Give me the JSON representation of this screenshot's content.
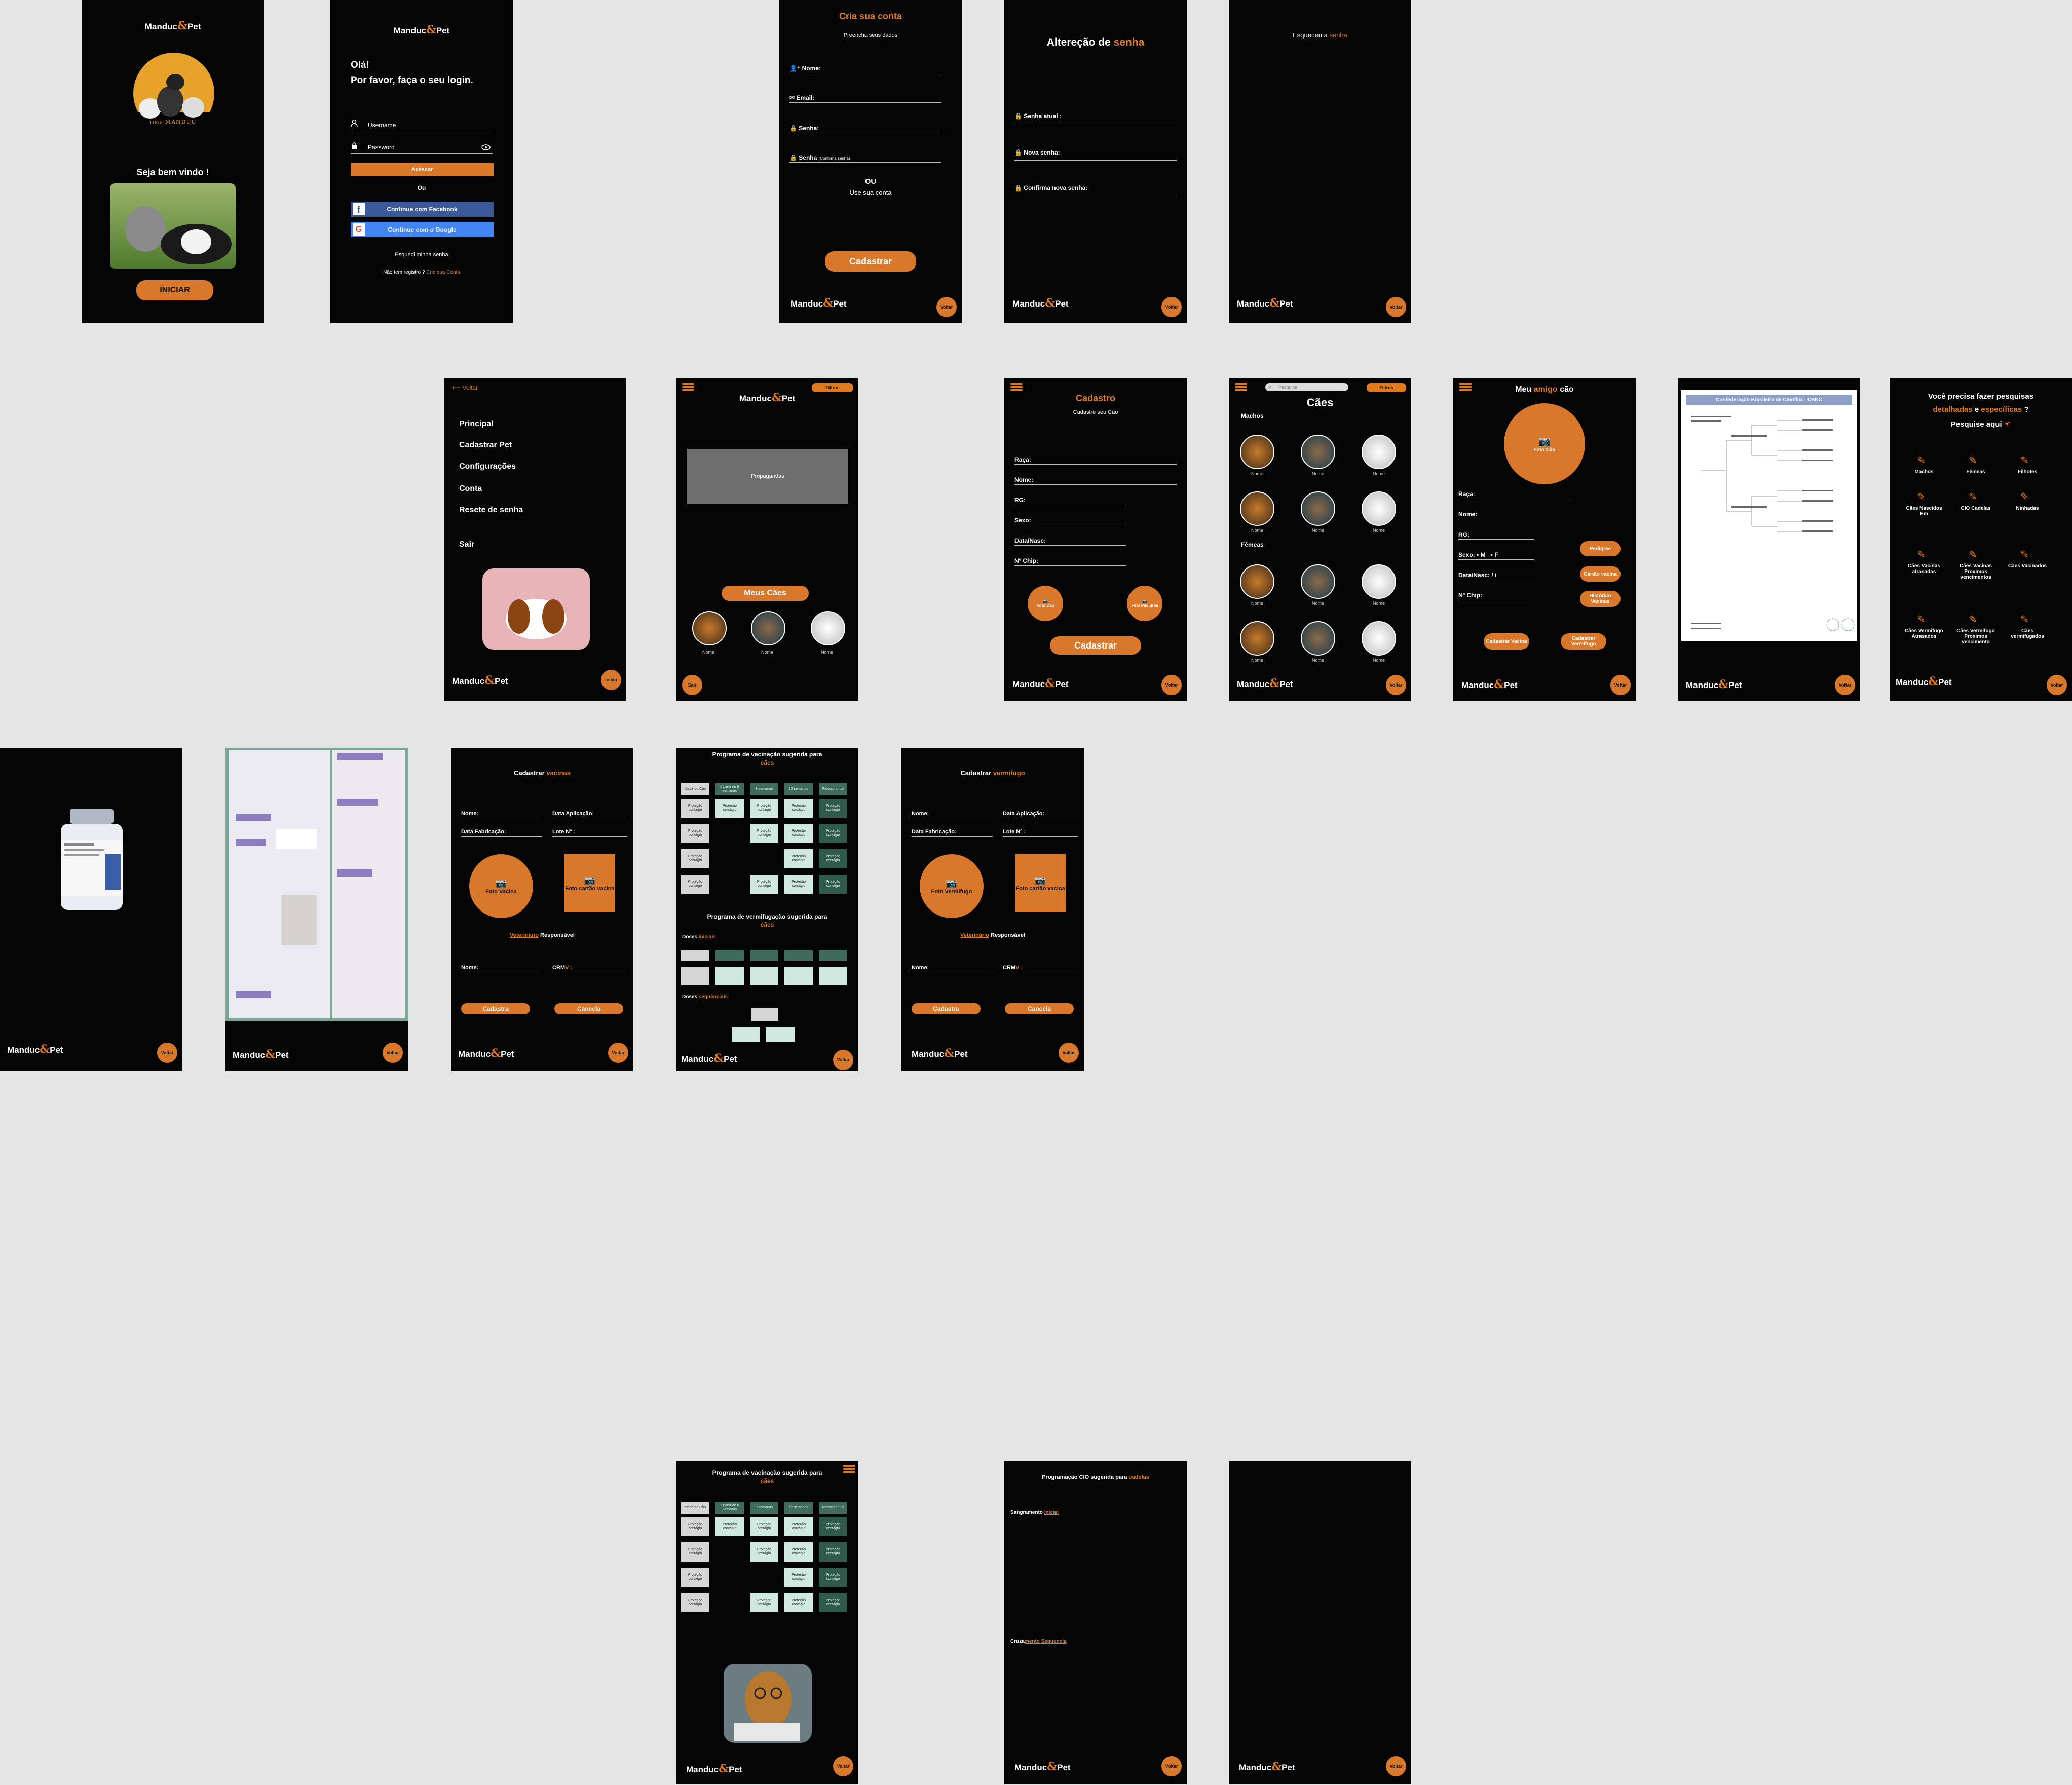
{
  "brand": {
    "manduc": "Manduc",
    "amp": "&",
    "pet": "Pet"
  },
  "common": {
    "voltar": "Voltar",
    "inicio": "Início"
  },
  "welcome": {
    "badge_sub": "TIME",
    "badge_name": "MANDUC",
    "greeting": "Seja bem vindo !",
    "start": "INICIAR"
  },
  "login": {
    "hello": "Olá!",
    "prompt": "Por favor, faça o seu login.",
    "username": "Username",
    "password": "Password",
    "access": "Acessar",
    "or": "Ou",
    "facebook": "Continue com Facebook",
    "google": "Continue com o Google",
    "forgot": "Esqueci minha senha",
    "no_account": "Não tem registro ?",
    "create": "Crie sua Conta"
  },
  "signup": {
    "title": "Cria sua conta",
    "subtitle": "Preencha seus dados",
    "name": "Nome:",
    "email": "Email:",
    "password": "Senha:",
    "confirm": "Senha",
    "confirm_small": "(Confirma senha)",
    "or": "OU",
    "use_account": "Use sua conta",
    "submit": "Cadastrar"
  },
  "pwchange": {
    "title_a": "Altereção de",
    "title_b": "senha",
    "current": "Senha atual :",
    "new": "Nova senha:",
    "confirm": "Confirma nova senha:"
  },
  "forgot": {
    "title_a": "Esqueceu a",
    "title_b": "senha"
  },
  "menu": {
    "back": "Voltar",
    "items": [
      "Principal",
      "Cadastrar Pet",
      "Configurações",
      "Conta",
      "Resete de senha"
    ],
    "exit": "Sair",
    "start": "Início"
  },
  "home": {
    "filters": "Filtros",
    "ads": "Propagandas",
    "my_dogs": "Meus Cães",
    "dog_name": "Nome",
    "exit": "Sair"
  },
  "register": {
    "title": "Cadastro",
    "subtitle": "Cadastre seu Cão",
    "fields": [
      "Raça:",
      "Nome:",
      "RG:",
      "Sexo:",
      "Data/Nasc:",
      "Nº Chip:"
    ],
    "photo_dog": "Foto Cão",
    "photo_ped": "Foto Pedigree",
    "submit": "Cadastrar"
  },
  "list": {
    "search": "Pesquisa",
    "filters": "Filtros",
    "title": "Cães",
    "males": "Machos",
    "females": "Fêmeas",
    "dog_name": "Nome"
  },
  "friend": {
    "title_a": "Meu",
    "title_b": "amigo",
    "title_c": "cão",
    "photo": "Foto Cão",
    "fields": [
      "Raça:",
      "Nome:",
      "RG:",
      "Sexo:",
      "Data/Nasc:",
      "Nº Chip:"
    ],
    "sex_m": "M",
    "sex_f": "F",
    "date_sep": "/   /",
    "btn_ped": "Pedigree",
    "btn_card": "Cartão vacina",
    "btn_hist": "Histórico Vacinas",
    "btn_vac": "Cadastrar Vacina",
    "btn_verm": "Cadastrar Vermifugo"
  },
  "pedigree": {
    "header": "Confederação Brasileira de Cinofilia - CBKC"
  },
  "search": {
    "title_a": "Você precisa fazer pesquisas",
    "title_b": "detalhadas",
    "title_c": "e",
    "title_d": "específicas",
    "title_e": "?",
    "here": "Pesquise aqui",
    "items": [
      "Machos",
      "Fêmeas",
      "Filhotes",
      "Cães Nascidos Em",
      "CIO Cadelas",
      "Ninhadas",
      "Cães Vacinas atrasadas",
      "Cães Vacinas Proximos vencimentos",
      "Cães Vacinados",
      "Cães Vermifugo Atrasados",
      "Cães Vermifugo Proximos vencimento",
      "Cães vermifugados"
    ]
  },
  "vac": {
    "title_a": "Cadastrar",
    "title_b": "vacinas",
    "name": "Nome:",
    "app_date": "Data Aplicação:",
    "fab_date": "Data Fabricação:",
    "lot": "Lote Nº :",
    "photo_vac": "Foto Vacina",
    "photo_card": "Foto cartão vacina",
    "vet_a": "Veterinário",
    "vet_b": "Responsável",
    "crm": "CRM",
    "crm_suffix": "V :",
    "save": "Cadastra",
    "cancel": "Cancela"
  },
  "verm": {
    "title_a": "Cadastrar",
    "title_b": "vermifugo",
    "photo": "Foto Vermifugo",
    "photo_card": "Foto cartão vacina"
  },
  "program": {
    "vac_title": "Programa de vacinação sugerida para",
    "vac_title_b": "cães",
    "verm_title": "Programa de vermifugação sugerida para",
    "verm_title_b": "cães",
    "initial_a": "Doses",
    "initial_b": "iniciais",
    "seq_a": "Doses",
    "seq_b": "sequênciais",
    "headers": [
      "Idade do Cão",
      "6 partir de 6 semanas",
      "9 semanas",
      "12 semanas",
      "Reforço anual"
    ],
    "cell": "Proteção contágio"
  },
  "cio": {
    "title_a": "Programação CIO sugerida para",
    "title_b": "cadelas",
    "bleed_a": "Sangramento",
    "bleed_b": "inicial",
    "cross_a": "Cruza",
    "cross_b": "mento Sequencia"
  }
}
